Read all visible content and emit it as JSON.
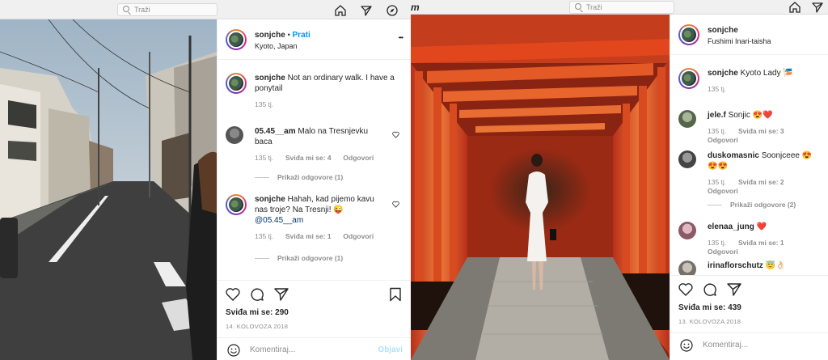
{
  "left": {
    "search_placeholder": "Traži",
    "post": {
      "username": "sonjche",
      "follow_label": "Prati",
      "separator": "•",
      "location": "Kyoto, Japan",
      "more": "•••",
      "caption": "Not an ordinary walk. I have a ponytail",
      "caption_time": "135 tj.",
      "comments": [
        {
          "user": "05.45__am",
          "text": "Malo na Tresnjevku baca",
          "time": "135 tj.",
          "likes": "Sviđa mi se: 4",
          "reply": "Odgovori",
          "view_replies": "Prikaži odgovore (1)"
        },
        {
          "user": "sonjche",
          "text": "Hahah, kad pijemo kavu nas troje? Na Tresnji! 😜",
          "mention": "@05.45__am",
          "time": "135 tj.",
          "likes": "Sviđa mi se: 1",
          "reply": "Odgovori",
          "view_replies": "Prikaži odgovore (1)"
        }
      ],
      "likes_label": "Sviđa mi se: 290",
      "date": "14. KOLOVOZA 2018",
      "add_comment_placeholder": "Komentiraj...",
      "post_button": "Objavi"
    }
  },
  "right": {
    "search_placeholder": "Traži",
    "post": {
      "username": "sonjche",
      "location": "Fushimi Inari-taisha",
      "caption": "Kyoto Lady 🎏",
      "caption_time": "135 tj.",
      "comments": [
        {
          "user": "jele.f",
          "text": "Sonjic 😍❤️",
          "time": "135 tj.",
          "likes": "Sviđa mi se: 3",
          "reply": "Odgovori"
        },
        {
          "user": "duskomasnic",
          "text": "Soonjceee 😍😍😍",
          "time": "135 tj.",
          "likes": "Sviđa mi se: 2",
          "reply": "Odgovori",
          "view_replies": "Prikaži odgovore (2)"
        },
        {
          "user": "elenaa_jung",
          "text": "❤️",
          "time": "135 tj.",
          "likes": "Sviđa mi se: 1",
          "reply": "Odgovori"
        },
        {
          "user": "irinaflorschutz",
          "text": "😇👌🏻"
        }
      ],
      "likes_label": "Sviđa mi se: 439",
      "date": "13. KOLOVOZA 2018",
      "add_comment_placeholder": "Komentiraj..."
    }
  },
  "icons": [
    "home-icon",
    "direct-icon",
    "explore-icon",
    "heart-icon",
    "comment-icon",
    "share-icon",
    "bookmark-icon",
    "emoji-icon",
    "more-icon"
  ],
  "colors": {
    "link": "#0095f6",
    "muted": "#8e8e8e",
    "torii": "#e2461d"
  }
}
